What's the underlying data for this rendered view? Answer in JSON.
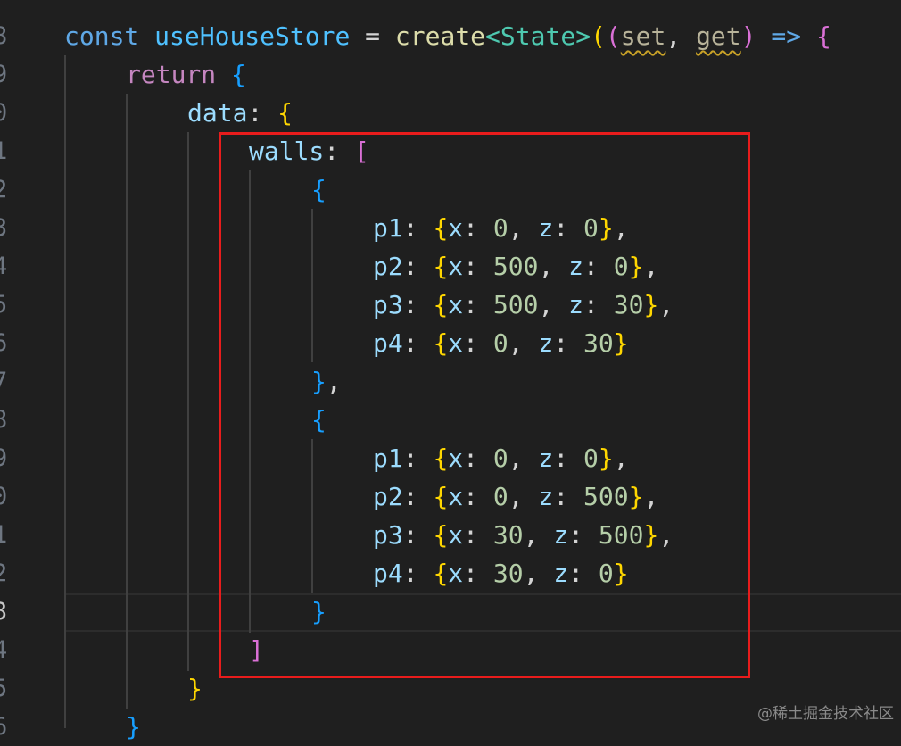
{
  "editor": {
    "line_numbers": [
      "8",
      "9",
      "0",
      "1",
      "2",
      "3",
      "4",
      "5",
      "6",
      "7",
      "8",
      "9",
      "0",
      "1",
      "2",
      "3",
      "4",
      "5",
      "6"
    ],
    "active_line_number": "3",
    "colors": {
      "background": "#1f1f1f",
      "highlight_border": "#e81c1c"
    }
  },
  "code": {
    "l0": {
      "kw": "const",
      "name": "useHouseStore",
      "eq": "=",
      "fn": "create",
      "lt": "<",
      "type": "State",
      "gt": ">",
      "p1": "(",
      "p2": "(",
      "set": "set",
      "comma": ",",
      "get": "get",
      "p2c": ")",
      "arrow": "=>",
      "brace": "{"
    },
    "l1": {
      "kw": "return",
      "brace": "{"
    },
    "l2": {
      "key": "data",
      "colon": ":",
      "brace": "{"
    },
    "l3": {
      "key": "walls",
      "colon": ":",
      "bracket": "["
    },
    "l4": {
      "brace": "{"
    },
    "l5": {
      "key": "p1",
      "colon": ":",
      "ob": "{",
      "xk": "x",
      "xv": "0",
      "zk": "z",
      "zv": "0",
      "cb": "}",
      "tail": ","
    },
    "l6": {
      "key": "p2",
      "colon": ":",
      "ob": "{",
      "xk": "x",
      "xv": "500",
      "zk": "z",
      "zv": "0",
      "cb": "}",
      "tail": ","
    },
    "l7": {
      "key": "p3",
      "colon": ":",
      "ob": "{",
      "xk": "x",
      "xv": "500",
      "zk": "z",
      "zv": "30",
      "cb": "}",
      "tail": ","
    },
    "l8": {
      "key": "p4",
      "colon": ":",
      "ob": "{",
      "xk": "x",
      "xv": "0",
      "zk": "z",
      "zv": "30",
      "cb": "}",
      "tail": ""
    },
    "l9": {
      "brace": "}",
      "tail": ","
    },
    "l10": {
      "brace": "{"
    },
    "l11": {
      "key": "p1",
      "colon": ":",
      "ob": "{",
      "xk": "x",
      "xv": "0",
      "zk": "z",
      "zv": "0",
      "cb": "}",
      "tail": ","
    },
    "l12": {
      "key": "p2",
      "colon": ":",
      "ob": "{",
      "xk": "x",
      "xv": "0",
      "zk": "z",
      "zv": "500",
      "cb": "}",
      "tail": ","
    },
    "l13": {
      "key": "p3",
      "colon": ":",
      "ob": "{",
      "xk": "x",
      "xv": "30",
      "zk": "z",
      "zv": "500",
      "cb": "}",
      "tail": ","
    },
    "l14": {
      "key": "p4",
      "colon": ":",
      "ob": "{",
      "xk": "x",
      "xv": "30",
      "zk": "z",
      "zv": "0",
      "cb": "}",
      "tail": ""
    },
    "l15": {
      "brace": "}"
    },
    "l16": {
      "bracket": "]"
    },
    "l17": {
      "brace": "}"
    },
    "l18": {
      "brace": "}"
    }
  },
  "watermark": "@稀土掘金技术社区"
}
